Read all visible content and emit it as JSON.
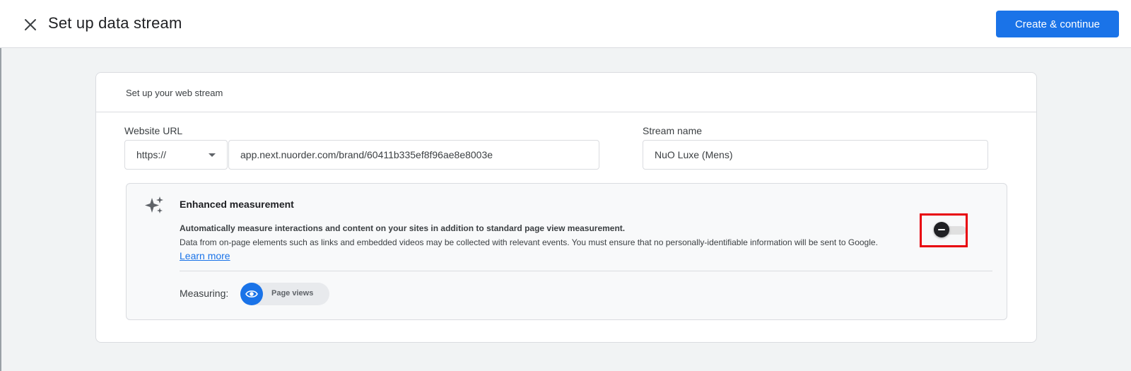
{
  "header": {
    "title": "Set up data stream",
    "primary_button": "Create & continue"
  },
  "card": {
    "title": "Set up your web stream",
    "website_url": {
      "label": "Website URL",
      "protocol": "https://",
      "value": "app.next.nuorder.com/brand/60411b335ef8f96ae8e8003e"
    },
    "stream_name": {
      "label": "Stream name",
      "value": "NuO Luxe (Mens)"
    },
    "enhanced_measurement": {
      "title": "Enhanced measurement",
      "description": "Automatically measure interactions and content on your sites in addition to standard page view measurement.",
      "note": "Data from on-page elements such as links and embedded videos may be collected with relevant events. You must ensure that no personally-identifiable information will be sent to Google.",
      "learn_more": "Learn more",
      "measuring_label": "Measuring:",
      "chips": [
        {
          "label": "Page views",
          "icon": "eye-icon"
        }
      ],
      "toggle_enabled": false
    }
  },
  "colors": {
    "accent": "#1a73e8",
    "highlight": "#e8000b"
  }
}
